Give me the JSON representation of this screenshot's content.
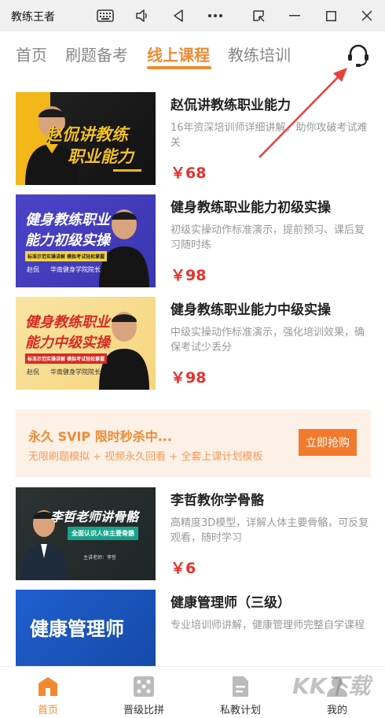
{
  "window": {
    "title": "教练王者"
  },
  "tabs": [
    {
      "label": "首页"
    },
    {
      "label": "刷题备考"
    },
    {
      "label": "线上课程"
    },
    {
      "label": "教练培训"
    }
  ],
  "courses": [
    {
      "title": "赵侃讲教练职业能力",
      "desc": "16年资深培训师详细讲解，助你攻破考试难关",
      "price": "￥68",
      "thumb": {
        "line1": "赵侃讲教练",
        "line2": "职业能力"
      }
    },
    {
      "title": "健身教练职业能力初级实操",
      "desc": "初级实操动作标准演示，提前预习、课后复习随时练",
      "price": "￥98",
      "thumb": {
        "line1": "健身教练职业",
        "line2": "能力初级实操",
        "tag": "标准示范实操讲解 模拟考试轻松掌握",
        "author": "赵侃",
        "org": "华南健身学院院长"
      }
    },
    {
      "title": "健身教练职业能力中级实操",
      "desc": "中级实操动作标准演示，强化培训效果，确保考试少丢分",
      "price": "￥98",
      "thumb": {
        "line1": "健身教练职业",
        "line2": "能力中级实操",
        "tag": "标准示范实操讲解 模拟考试轻松掌握",
        "author": "赵侃",
        "org": "华南健身学院院长"
      }
    },
    {
      "title": "李哲教你学骨骼",
      "desc": "高精度3D模型，详解人体主要骨骼，可反复观看，随时学习",
      "price": "￥6",
      "thumb": {
        "line1": "李哲老师讲骨骼",
        "tag": "全面认识人体主要骨骼",
        "author": "主讲老师：李哲"
      }
    },
    {
      "title": "健康管理师（三级）",
      "desc": "专业培训师讲解，健康管理师完整自学课程",
      "price": "",
      "thumb": {
        "line1": "健康管理师"
      }
    }
  ],
  "promo": {
    "title": "永久 SVIP 限时秒杀中...",
    "subtitle": "无限刷题模拟 + 视频永久回看 + 全套上课计划模板",
    "button": "立即抢购"
  },
  "bottom_nav": [
    {
      "label": "首页",
      "icon": "home-icon"
    },
    {
      "label": "晋级比拼",
      "icon": "dice-icon"
    },
    {
      "label": "私教计划",
      "icon": "document-icon"
    },
    {
      "label": "我的",
      "icon": "user-icon"
    }
  ],
  "watermark": "KK下载",
  "colors": {
    "accent": "#f08a32",
    "price": "#e8312c",
    "promo_bg": "#fdf1e7"
  }
}
